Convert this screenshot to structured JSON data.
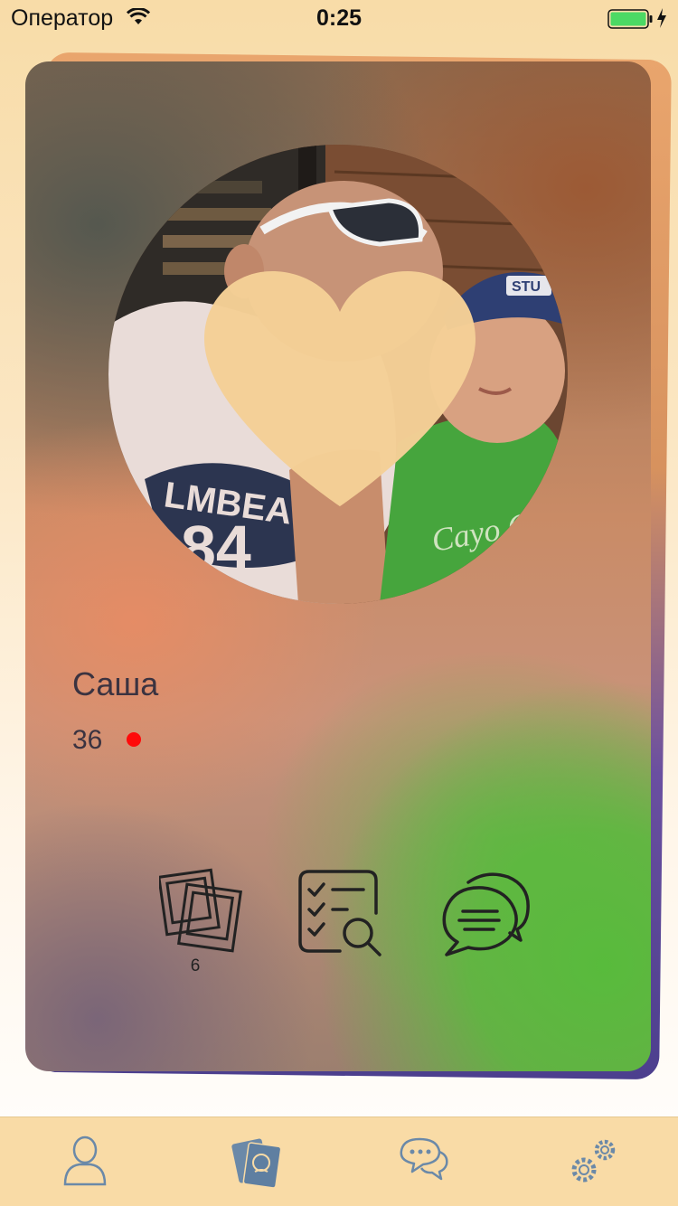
{
  "status_bar": {
    "carrier": "Оператор",
    "time": "0:25"
  },
  "profile": {
    "name": "Саша",
    "age": "36",
    "online": true,
    "photo_count": "6"
  },
  "icons": {
    "status": [
      "wifi-icon",
      "battery-icon",
      "charging-icon"
    ],
    "actions": [
      "photos-icon",
      "questionnaire-search-icon",
      "chat-icon"
    ],
    "tabs": [
      "profile-icon",
      "cards-icon",
      "messages-icon",
      "settings-icon"
    ]
  },
  "colors": {
    "background": "#f8dca8",
    "tab_bar": "#f9dba6",
    "tab_icon": "#6b89a8",
    "online_dot": "#ff0a0a",
    "heart_overlay": "#f4cf96",
    "battery": "#4cd964"
  },
  "tab_bar": {
    "active_index": 1
  }
}
